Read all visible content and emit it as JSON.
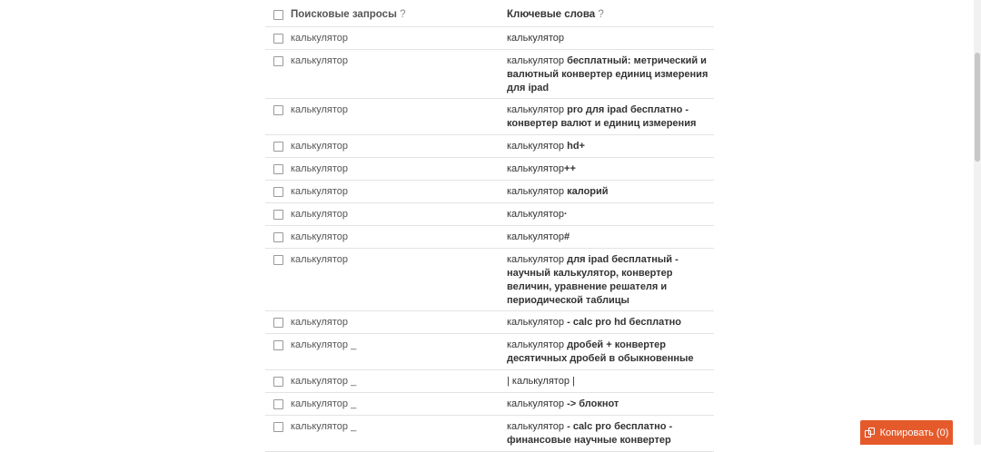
{
  "header": {
    "queries_label": "Поисковые запросы",
    "keywords_label": "Ключевые слова",
    "help_mark": "?"
  },
  "rows": [
    {
      "query": "калькулятор",
      "kw_pre": "калькулятор",
      "kw_bold": ""
    },
    {
      "query": "калькулятор",
      "kw_pre": "калькулятор",
      "kw_bold": " бесплатный: метрический и валютный конвертер единиц измерения для ipad"
    },
    {
      "query": "калькулятор",
      "kw_pre": "калькулятор",
      "kw_bold": " pro для ipad бесплатно - конвертер валют и единиц измерения"
    },
    {
      "query": "калькулятор",
      "kw_pre": "калькулятор",
      "kw_bold": " hd+"
    },
    {
      "query": "калькулятор",
      "kw_pre": "калькулятор",
      "kw_bold": "++"
    },
    {
      "query": "калькулятор",
      "kw_pre": "калькулятор",
      "kw_bold": " калорий"
    },
    {
      "query": "калькулятор",
      "kw_pre": "калькулятор",
      "kw_bold": "·"
    },
    {
      "query": "калькулятор",
      "kw_pre": "калькулятор",
      "kw_bold": "#"
    },
    {
      "query": "калькулятор",
      "kw_pre": "калькулятор",
      "kw_bold": " для ipad бесплатный - научный калькулятор, конвертер величин, уравнение решателя и периодической таблицы"
    },
    {
      "query": "калькулятор",
      "kw_pre": "калькулятор",
      "kw_bold": " - calc pro hd бесплатно"
    },
    {
      "query": "калькулятор _",
      "kw_pre": "калькулятор",
      "kw_bold": " дробей + конвертер десятичных дробей в обыкновенные"
    },
    {
      "query": "калькулятор _",
      "kw_pre": "| калькулятор |",
      "kw_bold": ""
    },
    {
      "query": "калькулятор _",
      "kw_pre": "калькулятор",
      "kw_bold": " -> блокнот"
    },
    {
      "query": "калькулятор _",
      "kw_pre": "калькулятор",
      "kw_bold": " - calc pro бесплатно - финансовые научные конвертер"
    }
  ],
  "copy_button": {
    "label": "Копировать (0)"
  }
}
